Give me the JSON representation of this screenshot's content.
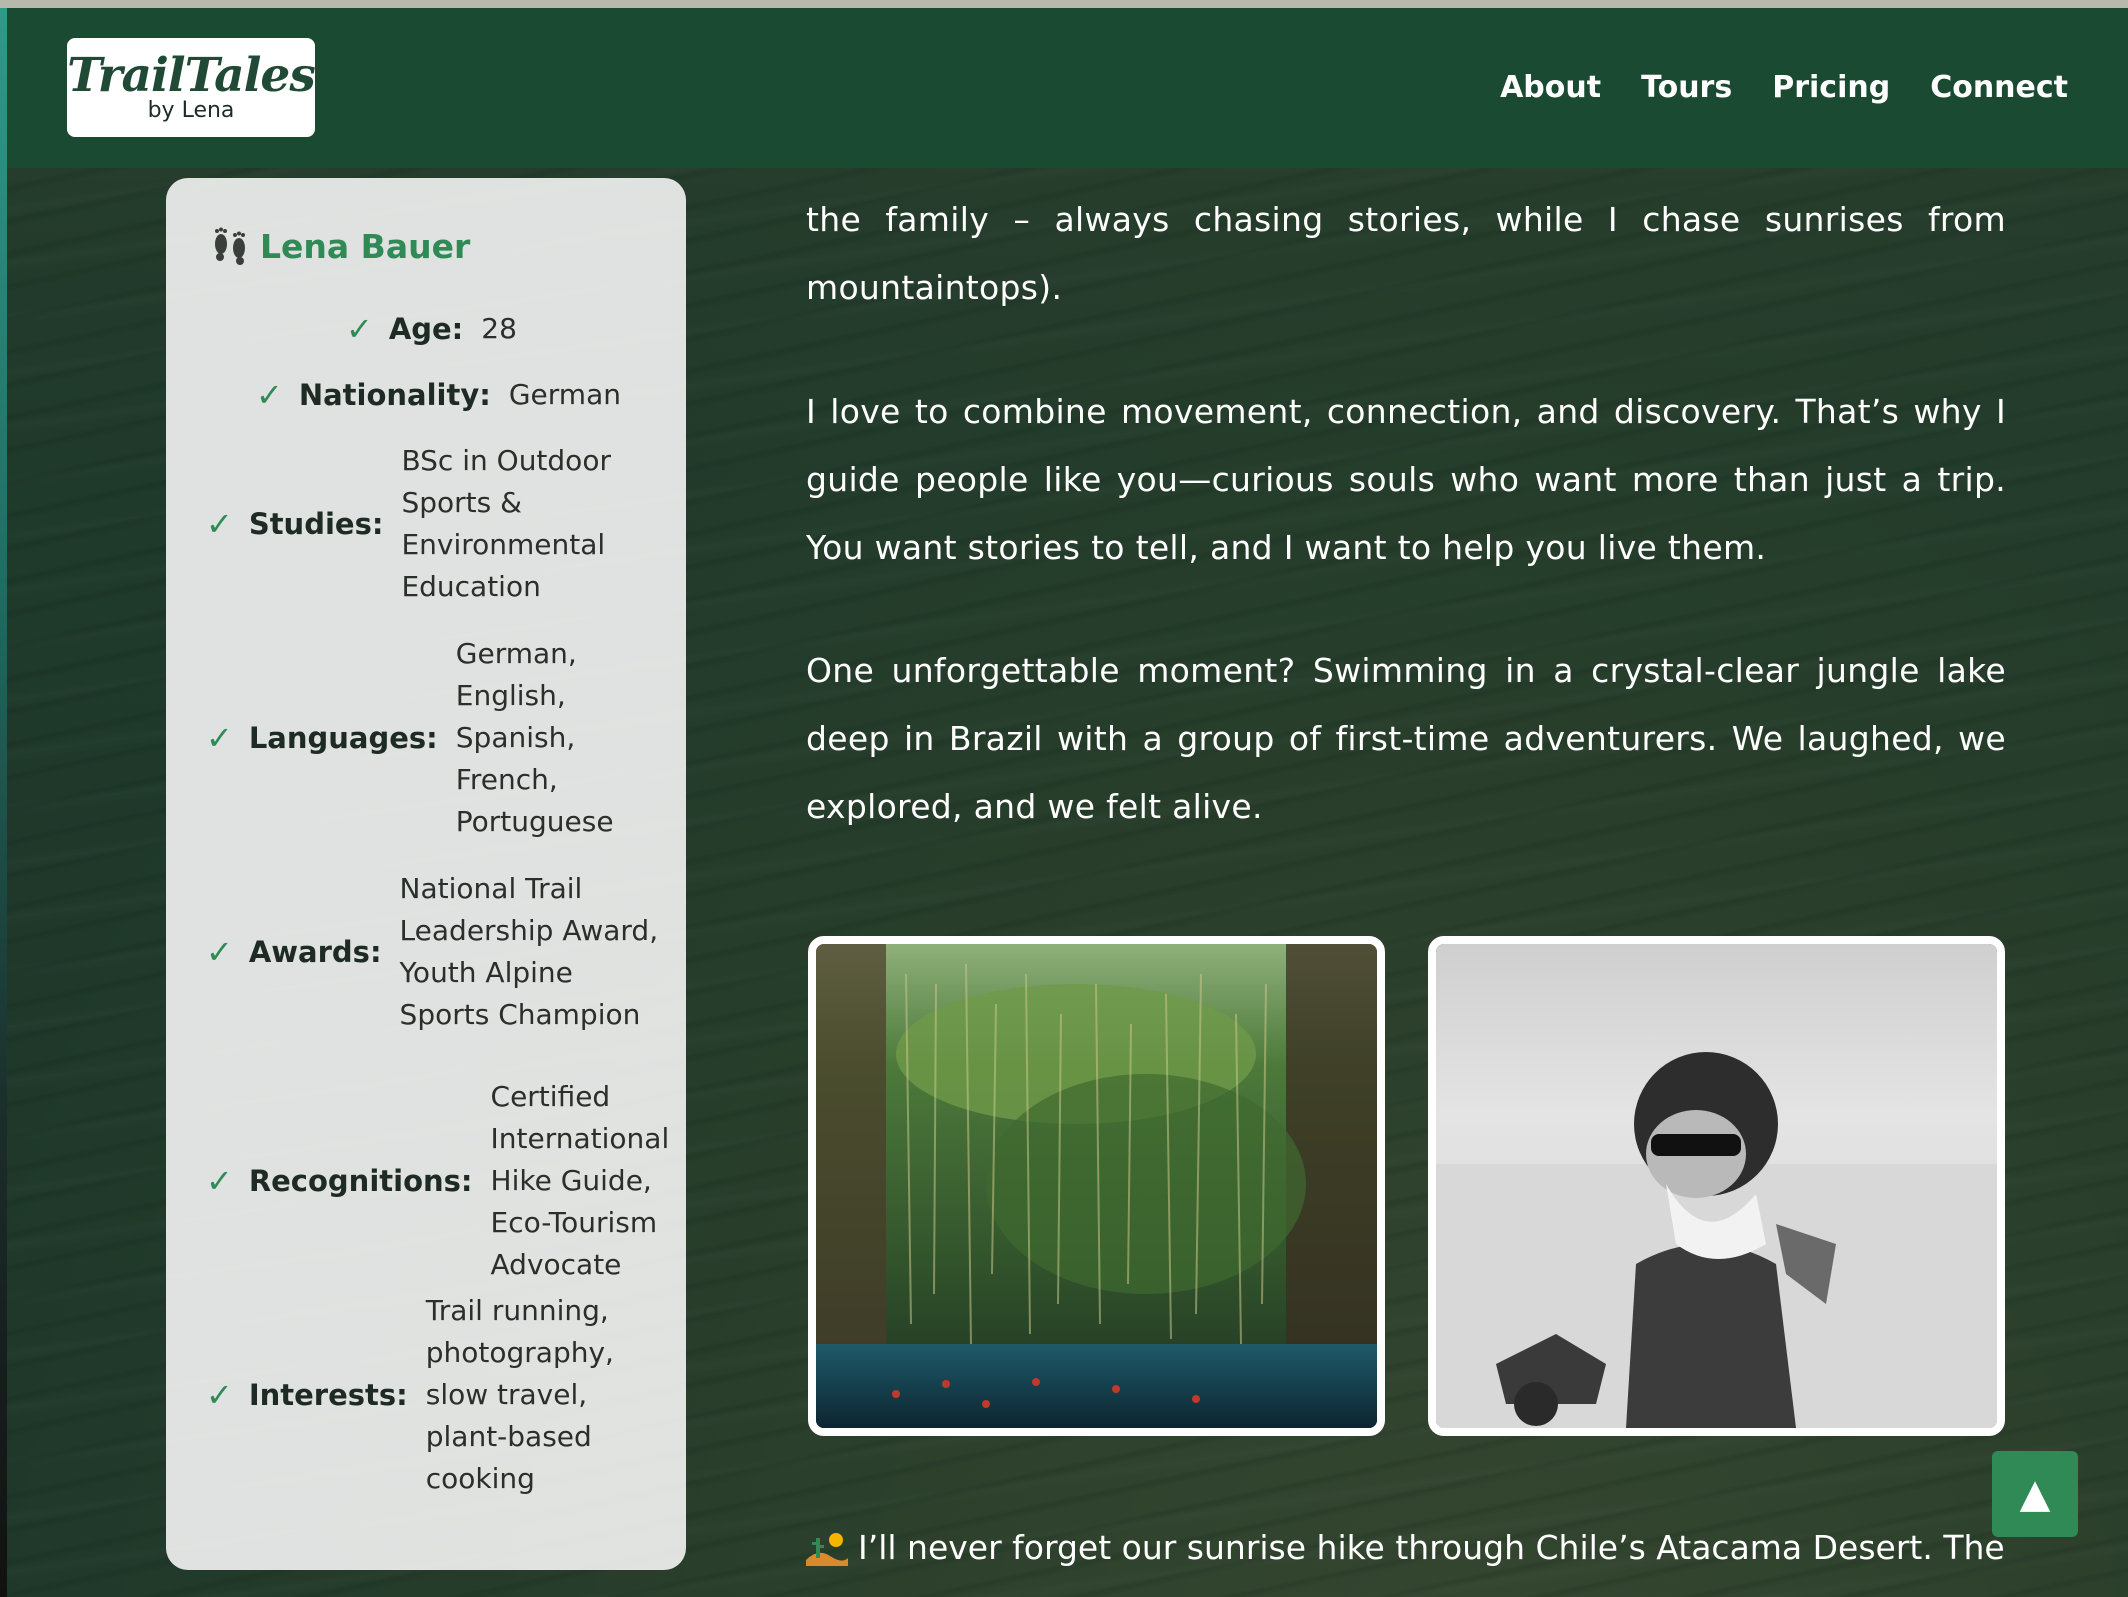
{
  "header": {
    "logo_main": "TrailTales",
    "logo_sub": "by Lena",
    "nav": [
      {
        "label": "About"
      },
      {
        "label": "Tours"
      },
      {
        "label": "Pricing"
      },
      {
        "label": "Connect"
      }
    ]
  },
  "profile": {
    "name": "Lena Bauer",
    "facts": [
      {
        "label": "Age:",
        "value": "28"
      },
      {
        "label": "Nationality:",
        "value": "German"
      },
      {
        "label": "Studies:",
        "value": "BSc in Outdoor Sports & Environmental Education"
      },
      {
        "label": "Languages:",
        "value": "German, English, Spanish, French, Portuguese"
      },
      {
        "label": "Awards:",
        "value": "National Trail Leadership Award, Youth Alpine Sports Champion"
      },
      {
        "label": "Recognitions:",
        "value": "Certified International Hike Guide, Eco-Tourism Advocate"
      },
      {
        "label": "Interests:",
        "value": "Trail running, photography, slow travel, plant-based cooking"
      }
    ]
  },
  "content": {
    "para1": "the family – always chasing stories, while I chase sunrises from mountaintops).",
    "para2": "I love to combine movement, connection, and discovery. That’s why I guide people like you—curious souls who want more than just a trip. You want stories to tell, and I want to help you live them.",
    "para3": "One unforgettable moment? Swimming in a crystal-clear jungle lake deep in Brazil with a group of first-time adventurers. We laughed, we explored, and we felt alive.",
    "bottom_line": "I’ll never forget our sunrise hike through Chile’s Atacama Desert. The"
  },
  "ui": {
    "back_to_top": "▲"
  },
  "colors": {
    "header_bg": "#1b4a33",
    "accent_green": "#2f8a56",
    "card_bg": "#f0f1f0"
  },
  "icons": [
    "footprints-icon",
    "check-icon",
    "desert-icon",
    "arrow-up-icon"
  ]
}
